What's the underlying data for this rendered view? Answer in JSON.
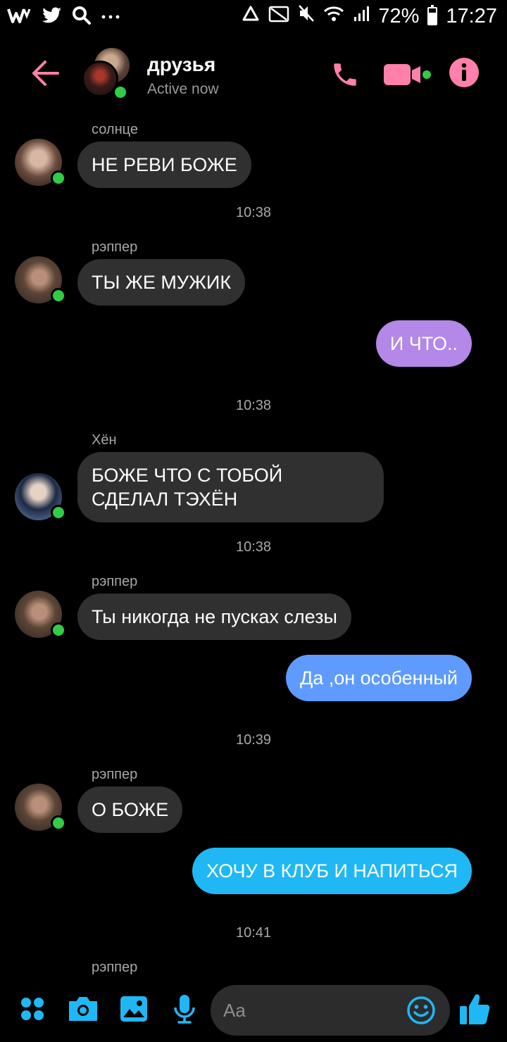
{
  "status_bar": {
    "battery_percent": "72%",
    "battery_level": 0.72,
    "time": "17:27",
    "left_icons": [
      "w-logo-icon",
      "twitter-icon",
      "search-icon",
      "more-dots-icon"
    ],
    "right_icons": [
      "recycle-icon",
      "cast-icon",
      "mute-icon",
      "wifi-icon",
      "signal-icon",
      "battery-icon"
    ]
  },
  "header": {
    "title": "друзья",
    "subtitle": "Active now",
    "accent_color": "#ff80ab"
  },
  "messages": [
    {
      "sender": "солнце",
      "text": "НЕ РЕВИ БОЖЕ",
      "direction": "in"
    },
    {
      "time": "10:38"
    },
    {
      "sender": "рэппер",
      "text": "ТЫ ЖЕ МУЖИК",
      "direction": "in"
    },
    {
      "text": "И ЧТО..",
      "direction": "out",
      "color": "#b388e8"
    },
    {
      "time": "10:38"
    },
    {
      "sender": "Хён",
      "text": "БОЖЕ ЧТО С ТОБОЙ\nСДЕЛАЛ ТЭХЁН",
      "direction": "in"
    },
    {
      "time": "10:38"
    },
    {
      "sender": "рэппер",
      "text": "Ты никогда не пусках слезы",
      "direction": "in"
    },
    {
      "text": "Да ,он особенный",
      "direction": "out",
      "color": "#5f9bff"
    },
    {
      "time": "10:39"
    },
    {
      "sender": "рэппер",
      "text": "О БОЖЕ",
      "direction": "in"
    },
    {
      "text": "ХОЧУ В КЛУБ И НАПИТЬСЯ",
      "direction": "out",
      "color": "#1fb8f5"
    },
    {
      "time": "10:41"
    },
    {
      "sender": "рэппер"
    }
  ],
  "composer": {
    "placeholder": "Aa",
    "icon_color": "#1fb8f5"
  },
  "online_color": "#31cc46"
}
